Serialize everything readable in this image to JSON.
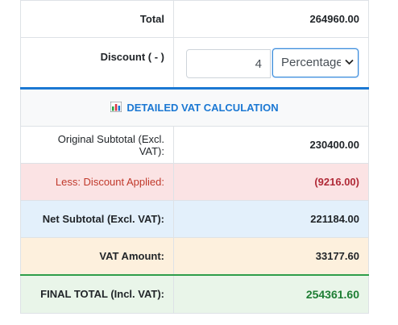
{
  "total": {
    "label": "Total",
    "value": "264960.00"
  },
  "discount": {
    "label": "Discount ( - )",
    "amount": "4",
    "type_selected": "Percentage"
  },
  "vat_section": {
    "icon": "bar-chart-icon",
    "title": "DETAILED VAT CALCULATION",
    "rows": {
      "original_subtotal": {
        "label": "Original Subtotal (Excl. VAT):",
        "value": "230400.00"
      },
      "discount_applied": {
        "label": "Less: Discount Applied:",
        "value": "(9216.00)"
      },
      "net_subtotal": {
        "label": "Net Subtotal (Excl. VAT):",
        "value": "221184.00"
      },
      "vat_amount": {
        "label": "VAT Amount:",
        "value": "33177.60"
      },
      "final_total": {
        "label": "FINAL TOTAL (Incl. VAT):",
        "value": "254361.60"
      }
    }
  },
  "colors": {
    "accent_blue": "#1b78d3",
    "discount_red": "#b02a37",
    "final_green": "#1e7e34"
  }
}
